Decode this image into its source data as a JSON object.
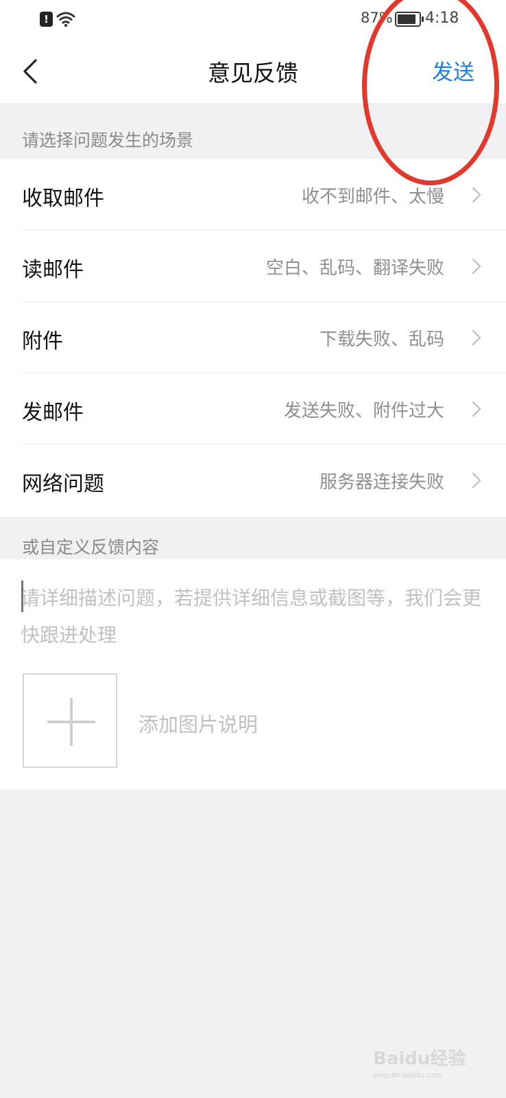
{
  "status_bar": {
    "battery": "87%",
    "time": "4:18"
  },
  "header": {
    "title": "意见反馈",
    "send_label": "发送"
  },
  "scenario_section": {
    "label": "请选择问题发生的场景",
    "items": [
      {
        "label": "收取邮件",
        "desc": "收不到邮件、太慢"
      },
      {
        "label": "读邮件",
        "desc": "空白、乱码、翻译失败"
      },
      {
        "label": "附件",
        "desc": "下载失败、乱码"
      },
      {
        "label": "发邮件",
        "desc": "发送失败、附件过大"
      },
      {
        "label": "网络问题",
        "desc": "服务器连接失败"
      }
    ]
  },
  "custom_section": {
    "label": "或自定义反馈内容",
    "placeholder": "请详细描述问题，若提供详细信息或截图等，我们会更快跟进处理",
    "add_photo_label": "添加图片说明"
  },
  "watermark": {
    "text": "Baidu经验",
    "url": "jingyan.baidu.com"
  },
  "colors": {
    "accent": "#1e7fd8",
    "annotation": "#e3392c",
    "background": "#f1f1f4"
  }
}
